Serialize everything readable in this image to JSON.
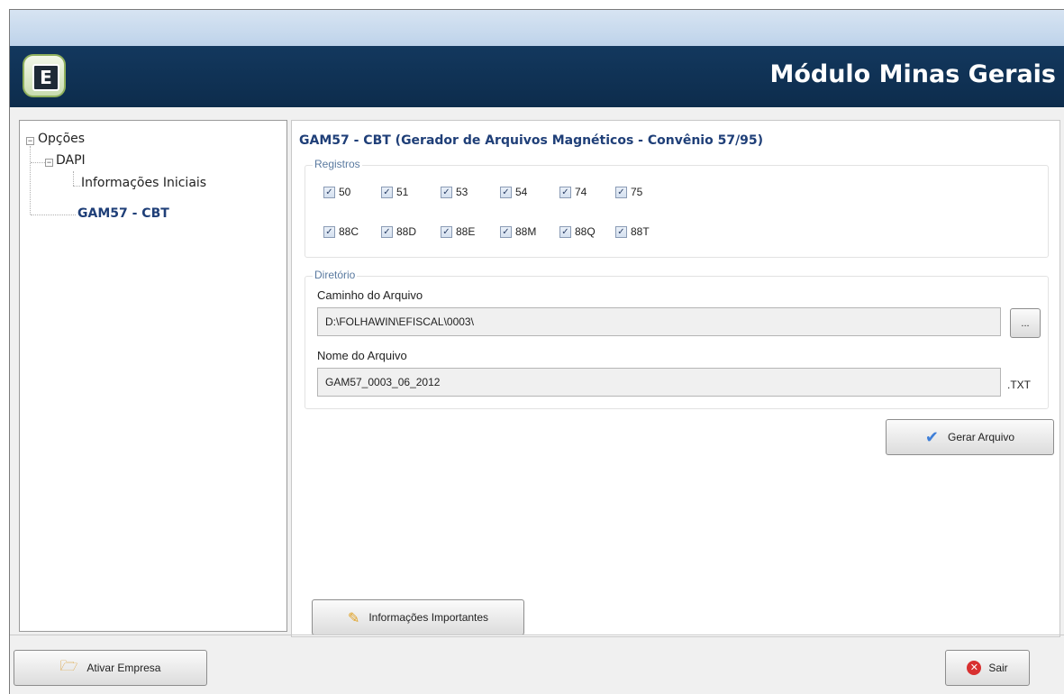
{
  "window": {
    "banner_title": "Módulo Minas Gerais",
    "logo_letter": "E"
  },
  "tree": {
    "root_label": "Opções",
    "dapi_label": "DAPI",
    "info_label": "Informações Iniciais",
    "gam_label": "GAM57 - CBT"
  },
  "content": {
    "title": "GAM57 - CBT (Gerador de Arquivos Magnéticos - Convênio 57/95)",
    "registros_legend": "Registros",
    "registros_row1": [
      "50",
      "51",
      "53",
      "54",
      "74",
      "75"
    ],
    "registros_row2": [
      "88C",
      "88D",
      "88E",
      "88M",
      "88Q",
      "88T"
    ],
    "diretorio_legend": "Diretório",
    "path_label": "Caminho do Arquivo",
    "path_value": "D:\\FOLHAWIN\\EFISCAL\\0003\\",
    "browse_label": "...",
    "name_label": "Nome do Arquivo",
    "name_value": "GAM57_0003_06_2012",
    "extension": ".TXT",
    "gerar_label": "Gerar Arquivo",
    "info_btn_label": "Informações Importantes"
  },
  "footer": {
    "ativar_label": "Ativar Empresa",
    "sair_label": "Sair"
  }
}
